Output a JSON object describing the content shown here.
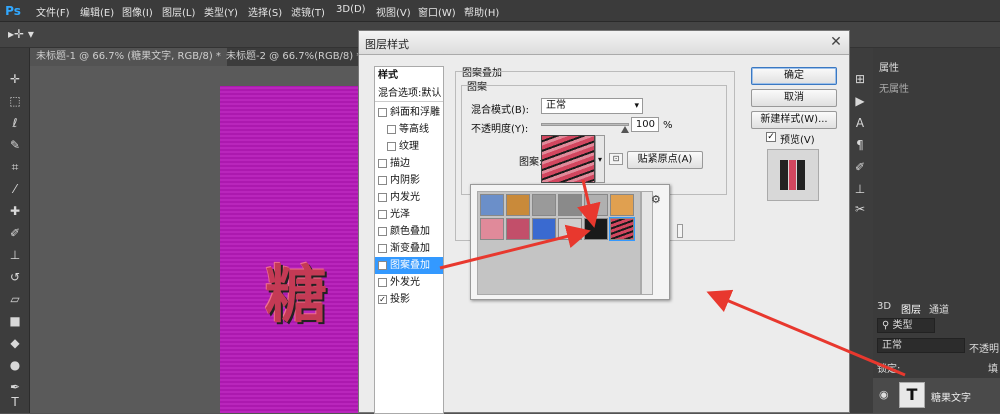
{
  "app": {
    "logo": "Ps"
  },
  "menu": [
    "文件(F)",
    "编辑(E)",
    "图像(I)",
    "图层(L)",
    "类型(Y)",
    "选择(S)",
    "滤镜(T)",
    "3D(D)",
    "视图(V)",
    "窗口(W)",
    "帮助(H)"
  ],
  "tabs": [
    "未标题-1 @ 66.7% (糖果文字, RGB/8) *",
    "未标题-2 @ 66.7%(RGB/8) *"
  ],
  "canvas": {
    "text": "糖"
  },
  "dialog": {
    "title": "图层样式",
    "styles_header": "样式",
    "blend_options": "混合选项:默认",
    "style_items": [
      {
        "label": "斜面和浮雕",
        "checked": false,
        "indent": false
      },
      {
        "label": "等高线",
        "checked": false,
        "indent": true
      },
      {
        "label": "纹理",
        "checked": false,
        "indent": true
      },
      {
        "label": "描边",
        "checked": false,
        "indent": false
      },
      {
        "label": "内阴影",
        "checked": false,
        "indent": false
      },
      {
        "label": "内发光",
        "checked": false,
        "indent": false
      },
      {
        "label": "光泽",
        "checked": false,
        "indent": false
      },
      {
        "label": "颜色叠加",
        "checked": false,
        "indent": false
      },
      {
        "label": "渐变叠加",
        "checked": false,
        "indent": false
      },
      {
        "label": "图案叠加",
        "checked": true,
        "indent": false,
        "selected": true
      },
      {
        "label": "外发光",
        "checked": false,
        "indent": false
      },
      {
        "label": "投影",
        "checked": true,
        "indent": false
      }
    ],
    "section_title": "图案叠加",
    "sub_title": "图案",
    "blend_mode_label": "混合模式(B):",
    "blend_mode_value": "正常",
    "opacity_label": "不透明度(Y):",
    "opacity_value": "100",
    "opacity_unit": "%",
    "pattern_label": "图案:",
    "snap_button": "贴紧原点(A)",
    "ok_button": "确定",
    "cancel_button": "取消",
    "new_style_button": "新建样式(W)...",
    "preview_label": "预览(V)",
    "preview_checked": true
  },
  "swatch_colors": [
    "#6b8fc9",
    "#c98a3a",
    "#9a9a9a",
    "#8a8a8a",
    "#b0b0b0",
    "#e0a050",
    "#e08a9a",
    "#c24f6a",
    "#3a6ad0",
    "#cfcfcf",
    "#1a1a1a",
    "#d2465f"
  ],
  "right_panel": {
    "properties_tab": "属性",
    "no_properties": "无属性",
    "layers_tabs": [
      "3D",
      "图层",
      "通道"
    ],
    "filter_label": "类型",
    "blend_value": "正常",
    "opacity_label": "不透明",
    "lock_label": "锁定:",
    "fill_label": "填",
    "layer_name": "糖果文字"
  },
  "colors": {
    "accent": "#3399ff",
    "arrow": "#e8382e",
    "canvas": "#b51ab8"
  }
}
